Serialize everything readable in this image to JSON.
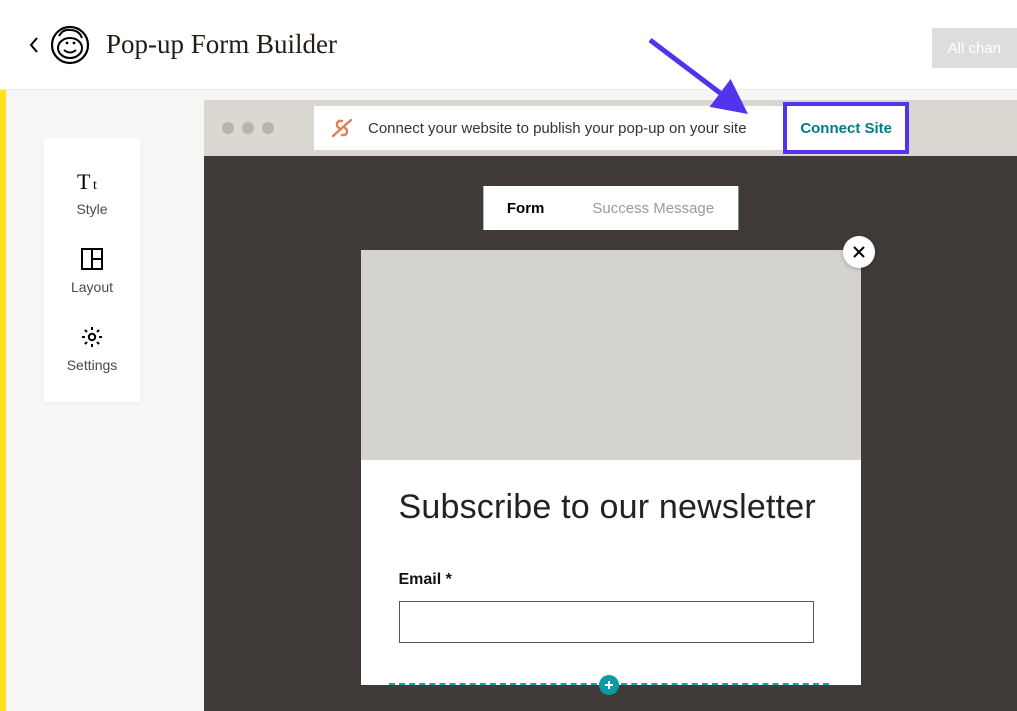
{
  "header": {
    "title": "Pop-up Form Builder",
    "all_changes_label": "All chan"
  },
  "sidebar": {
    "items": [
      {
        "label": "Style"
      },
      {
        "label": "Layout"
      },
      {
        "label": "Settings"
      }
    ]
  },
  "connect_bar": {
    "message": "Connect your website to publish your pop-up on your site",
    "button_label": "Connect Site"
  },
  "tabs": {
    "form": "Form",
    "success": "Success Message"
  },
  "popup": {
    "title": "Subscribe to our newsletter",
    "email_label": "Email *",
    "email_value": ""
  },
  "colors": {
    "highlight": "#5333ed",
    "teal": "#007c89"
  }
}
